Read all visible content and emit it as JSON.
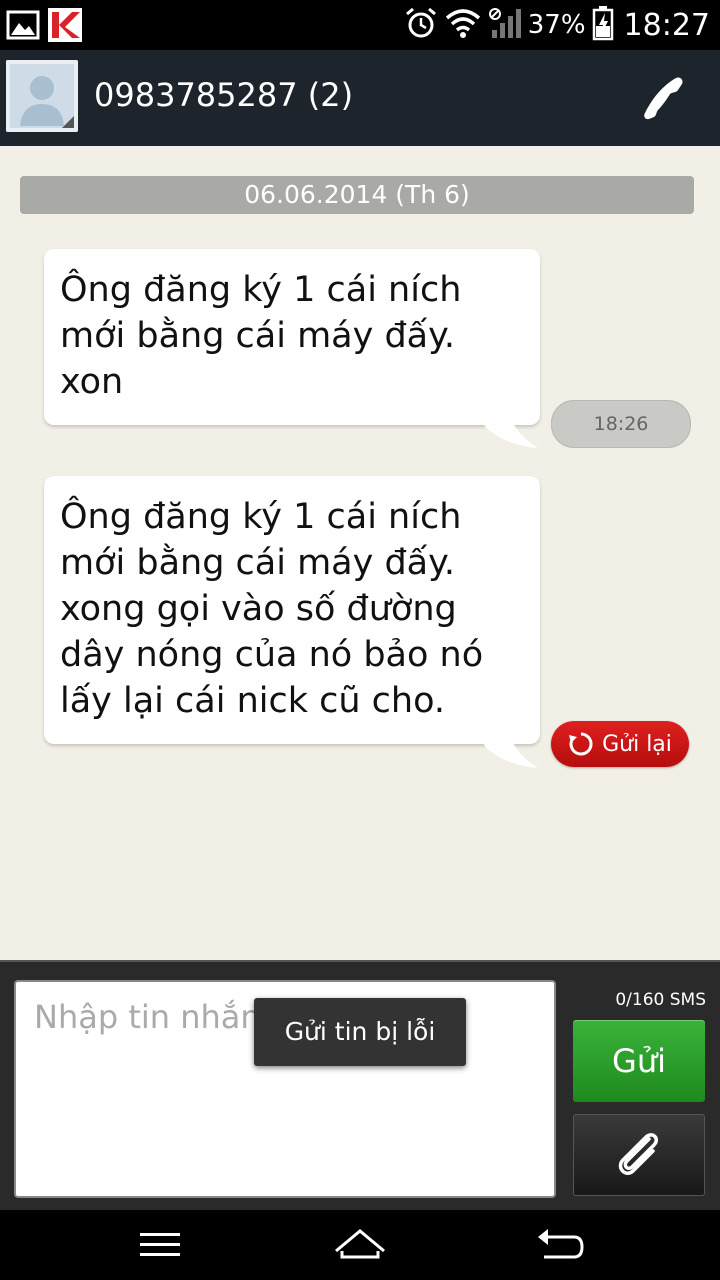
{
  "status_bar": {
    "left_icons": [
      "image-icon",
      "kaspersky-icon"
    ],
    "right_icons": [
      "alarm-icon",
      "wifi-icon",
      "signal-icon",
      "battery-charging-icon"
    ],
    "battery_percent": "37%",
    "time": "18:27"
  },
  "header": {
    "contact_title": "0983785287 (2)",
    "call_icon": "phone-icon"
  },
  "conversation": {
    "date_separator": "06.06.2014 (Th 6)",
    "messages": [
      {
        "text": "Ông đăng ký 1 cái ních\nmới bằng cái máy đấy.\nxon",
        "status": "18:26"
      },
      {
        "text": "Ông đăng ký 1 cái ních\nmới bằng cái máy đấy.\nxong gọi vào số đường\ndây nóng của nó bảo nó\nlấy lại cái nick cũ cho.",
        "status": "Gửi lại"
      }
    ]
  },
  "compose": {
    "placeholder": "Nhập tin nhắn",
    "counter": "0/160 SMS",
    "send_label": "Gửi",
    "attach_icon": "paperclip-icon"
  },
  "toast": {
    "text": "Gửi tin bị lỗi"
  },
  "navbar": {
    "buttons": [
      "menu-icon",
      "home-icon",
      "back-icon"
    ]
  },
  "colors": {
    "header_bg": "#1e242b",
    "conversation_bg": "#f2efe6",
    "send_green": "#2ea02e",
    "resend_red": "#c81414"
  }
}
